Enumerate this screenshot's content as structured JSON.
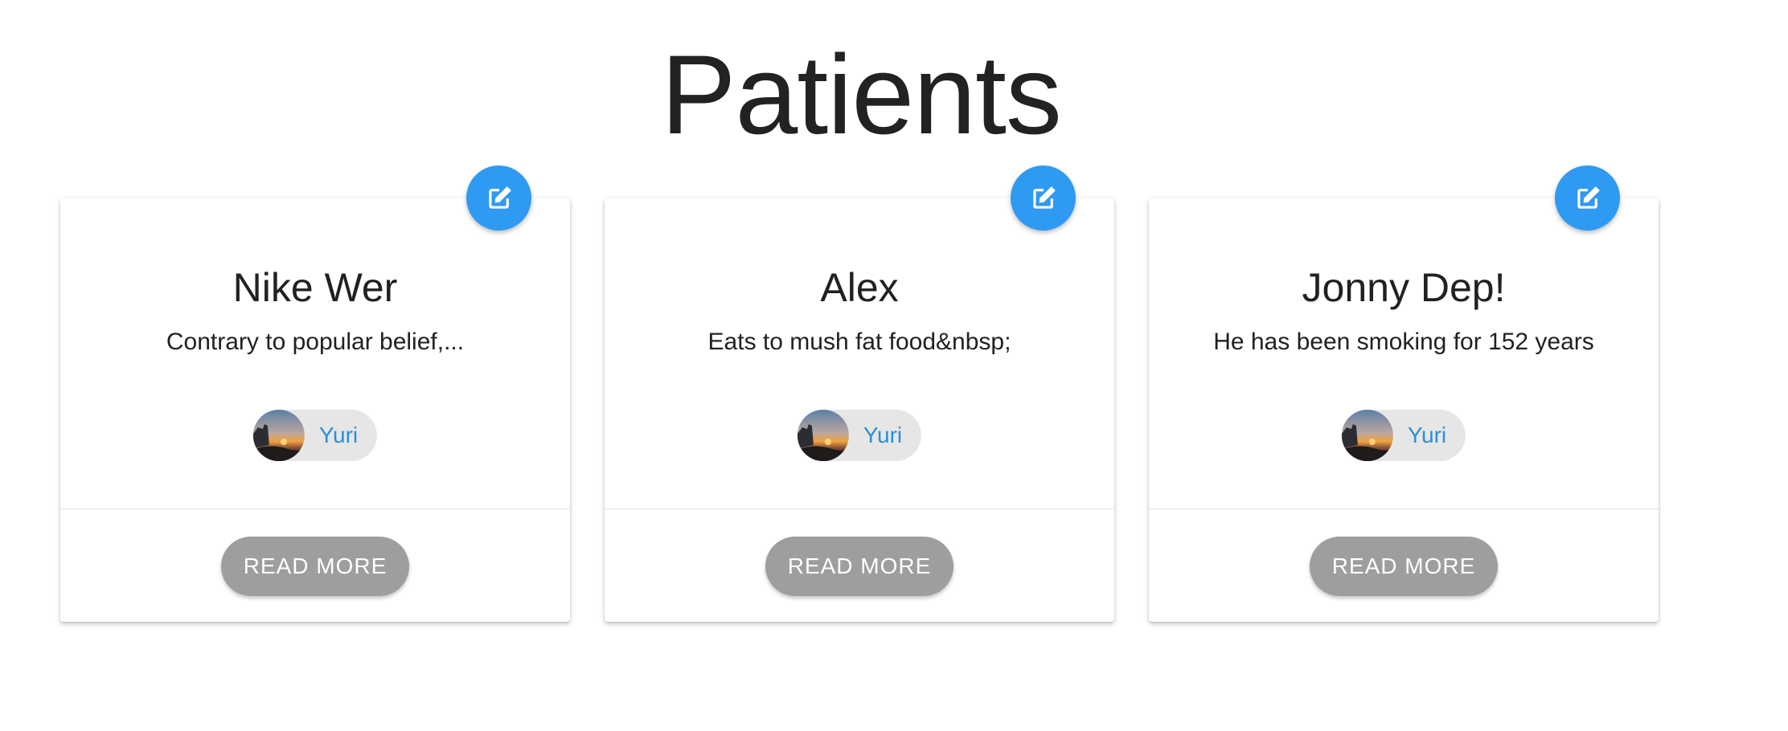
{
  "page": {
    "title": "Patients"
  },
  "colors": {
    "fab": "#2f9af2",
    "chip_background": "#e6e6e6",
    "chip_text": "#2b8fd9",
    "button_background": "#9e9e9e",
    "button_text": "#ffffff"
  },
  "cards": [
    {
      "name": "Nike Wer",
      "description": "Contrary to popular belief,...",
      "author": "Yuri",
      "button_label": "READ MORE",
      "edit_icon": "edit-icon"
    },
    {
      "name": "Alex",
      "description": "Eats to mush fat food&nbsp;",
      "author": "Yuri",
      "button_label": "READ MORE",
      "edit_icon": "edit-icon"
    },
    {
      "name": "Jonny Dep!",
      "description": "He has been smoking for 152 years",
      "author": "Yuri",
      "button_label": "READ MORE",
      "edit_icon": "edit-icon"
    }
  ]
}
